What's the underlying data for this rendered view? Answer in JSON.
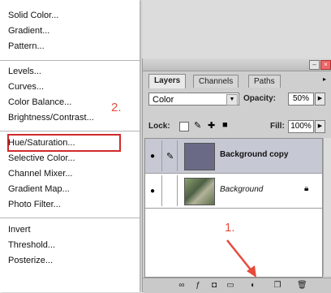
{
  "menu": {
    "items": [
      {
        "label": "Solid Color..."
      },
      {
        "label": "Gradient..."
      },
      {
        "label": "Pattern..."
      },
      {
        "label": "Levels..."
      },
      {
        "label": "Curves..."
      },
      {
        "label": "Color Balance..."
      },
      {
        "label": "Brightness/Contrast..."
      },
      {
        "label": "Hue/Saturation..."
      },
      {
        "label": "Selective Color..."
      },
      {
        "label": "Channel Mixer..."
      },
      {
        "label": "Gradient Map..."
      },
      {
        "label": "Photo Filter..."
      },
      {
        "label": "Invert"
      },
      {
        "label": "Threshold..."
      },
      {
        "label": "Posterize..."
      }
    ],
    "highlighted_index": 7
  },
  "annotations": {
    "step1": "1.",
    "step2": "2.",
    "color": "#e54b3b"
  },
  "panel": {
    "tabs": [
      {
        "label": "Layers",
        "active": true
      },
      {
        "label": "Channels",
        "active": false
      },
      {
        "label": "Paths",
        "active": false
      }
    ],
    "blend_mode": "Color",
    "opacity_label": "Opacity:",
    "opacity_value": "50%",
    "lock_label": "Lock:",
    "fill_label": "Fill:",
    "fill_value": "100%",
    "layers": [
      {
        "name": "Background copy",
        "selected": true,
        "thumb_color": "#6b6a86"
      },
      {
        "name": "Background",
        "selected": false,
        "locked": true
      }
    ]
  }
}
